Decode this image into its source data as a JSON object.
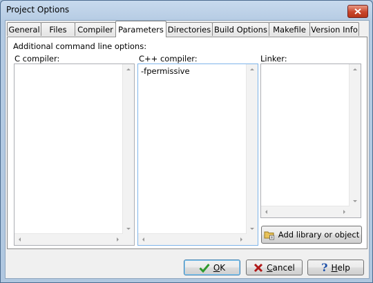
{
  "window": {
    "title": "Project Options"
  },
  "tabs": [
    {
      "label": "General"
    },
    {
      "label": "Files"
    },
    {
      "label": "Compiler"
    },
    {
      "label": "Parameters",
      "active": true
    },
    {
      "label": "Directories"
    },
    {
      "label": "Build Options"
    },
    {
      "label": "Makefile"
    },
    {
      "label": "Version Info"
    }
  ],
  "parameters": {
    "section_label": "Additional command line options:",
    "c_compiler": {
      "label": "C compiler:",
      "value": ""
    },
    "cpp_compiler": {
      "label": "C++ compiler:",
      "value": "-fpermissive"
    },
    "linker": {
      "label": "Linker:",
      "value": ""
    },
    "add_library_label": "Add library or object"
  },
  "buttons": {
    "ok": "OK",
    "cancel": "Cancel",
    "help": "Help"
  },
  "icons": {
    "close": "close-icon",
    "ok": "checkmark-icon",
    "cancel": "x-icon",
    "help": "question-icon",
    "add_library": "folder-icon"
  },
  "colors": {
    "titlebar": "#b5cbe3",
    "close": "#c8452c",
    "ok_check": "#2e9a2e",
    "cancel_x": "#b01818",
    "help_q": "#1c4fa8"
  }
}
